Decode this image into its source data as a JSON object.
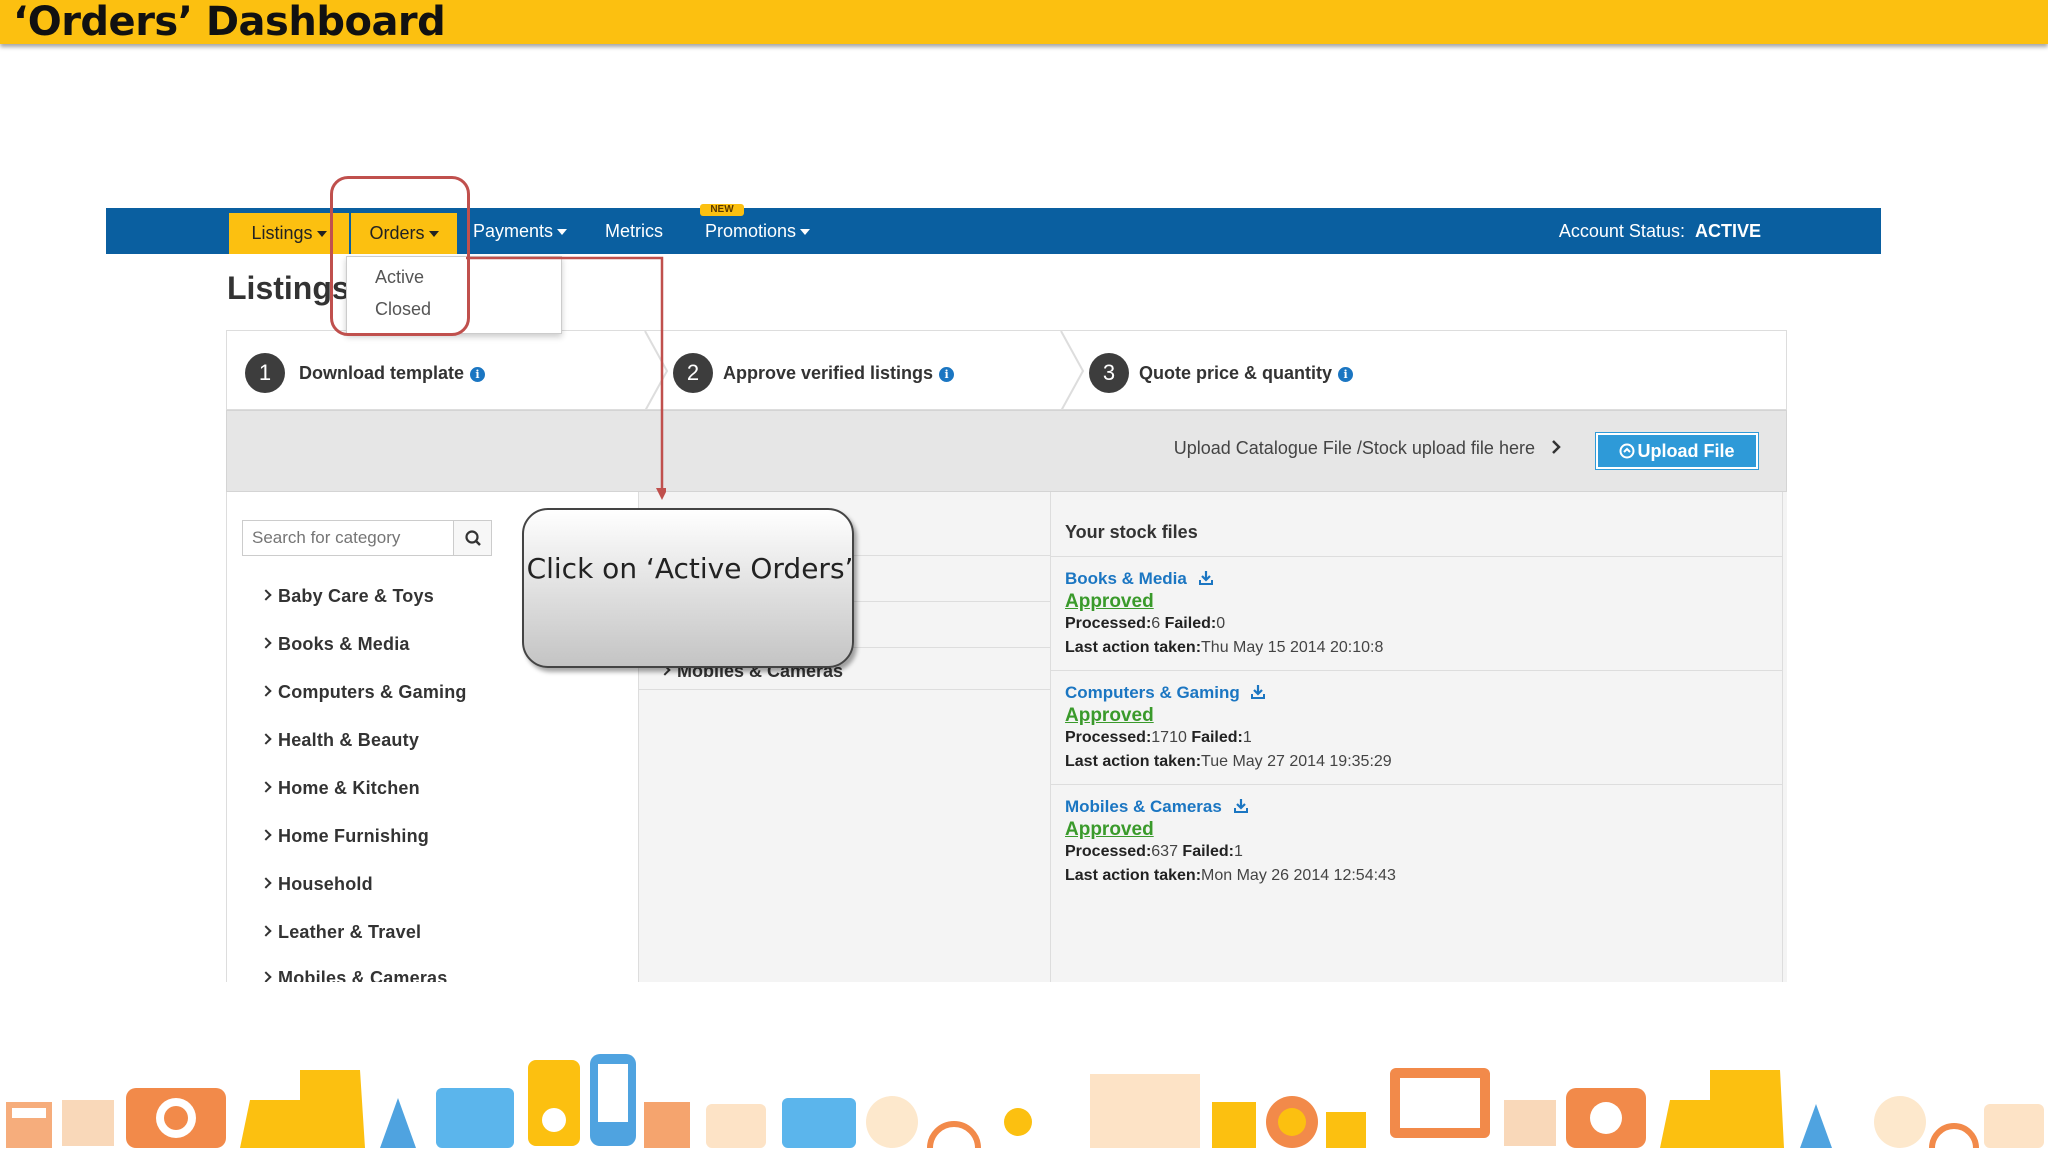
{
  "slide": {
    "title": "‘Orders’ Dashboard"
  },
  "nav": {
    "listings": "Listings",
    "orders": "Orders",
    "payments": "Payments",
    "metrics": "Metrics",
    "promotions": "Promotions",
    "new_badge": "NEW",
    "account_status_label": "Account Status:",
    "account_status_value": "ACTIVE"
  },
  "orders_menu": {
    "items": [
      "Active",
      "Closed"
    ]
  },
  "page": {
    "heading": "Listings"
  },
  "steps": [
    {
      "number": "1",
      "label": "Download template"
    },
    {
      "number": "2",
      "label": "Approve verified listings"
    },
    {
      "number": "3",
      "label": "Quote price & quantity"
    }
  ],
  "upload": {
    "text": "Upload Catalogue File /Stock upload file here",
    "button": "Upload File"
  },
  "search": {
    "placeholder": "Search for category"
  },
  "categories": [
    "Baby Care & Toys",
    "Books & Media",
    "Computers & Gaming",
    "Health & Beauty",
    "Home & Kitchen",
    "Home Furnishing",
    "Household",
    "Leather & Travel",
    "Mobiles & Cameras"
  ],
  "middle": {
    "visible_category": "Mobiles & Cameras"
  },
  "stock_files": {
    "title": "Your stock files",
    "items": [
      {
        "name": "Books & Media",
        "status": "Approved",
        "processed_label": "Processed:",
        "processed": "6",
        "failed_label": "Failed:",
        "failed": "0",
        "last_action_label": "Last action taken:",
        "last_action": "Thu May 15 2014 20:10:8"
      },
      {
        "name": "Computers & Gaming",
        "status": "Approved",
        "processed_label": "Processed:",
        "processed": "1710",
        "failed_label": "Failed:",
        "failed": "1",
        "last_action_label": "Last action taken:",
        "last_action": "Tue May 27 2014 19:35:29"
      },
      {
        "name": "Mobiles & Cameras",
        "status": "Approved",
        "processed_label": "Processed:",
        "processed": "637",
        "failed_label": "Failed:",
        "failed": "1",
        "last_action_label": "Last action taken:",
        "last_action": "Mon May 26 2014 12:54:43"
      }
    ]
  },
  "callout": {
    "text": "Click on ‘Active Orders’"
  },
  "colors": {
    "header_yellow": "#fcc010",
    "nav_blue": "#0a5fa0",
    "link_blue": "#1b76c2",
    "approved_green": "#3a9a2b",
    "highlight_red": "#c0504d"
  }
}
